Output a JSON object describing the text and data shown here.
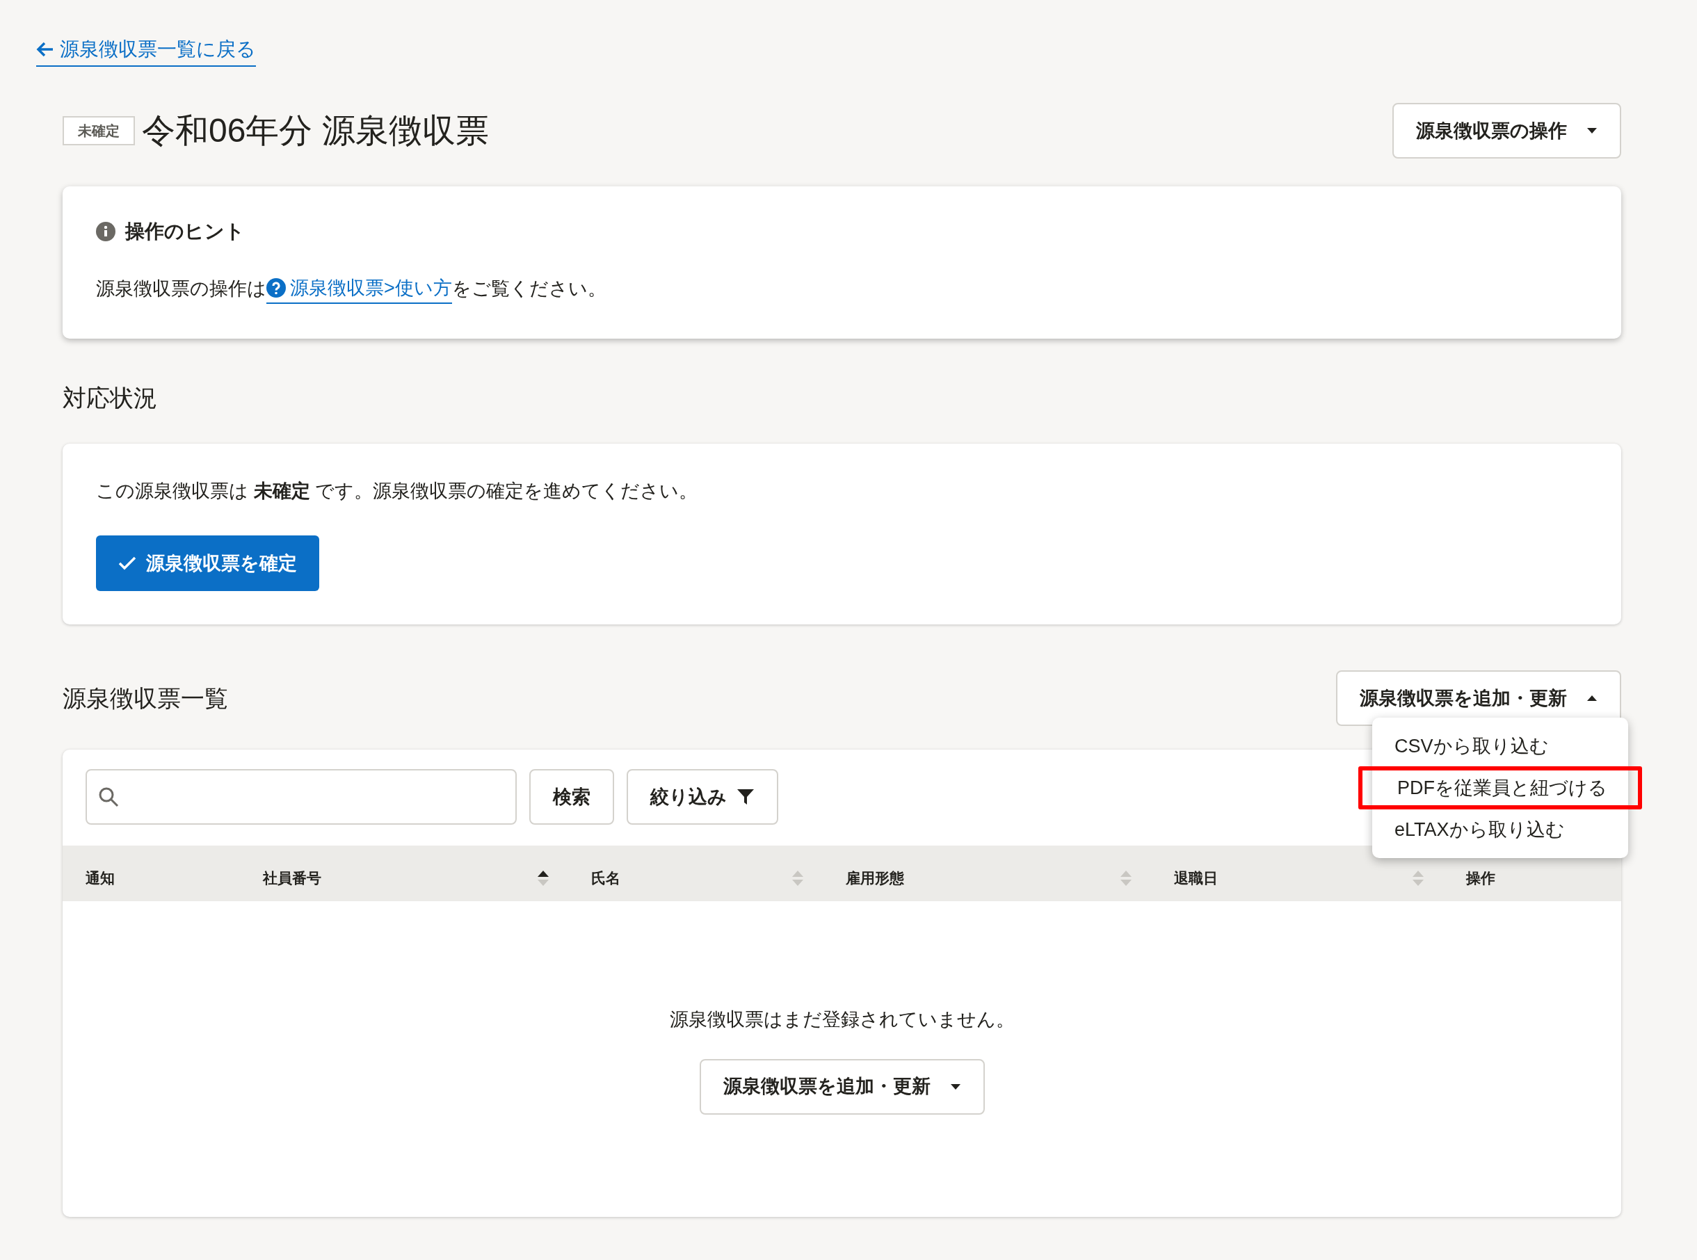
{
  "back_link": {
    "label": "源泉徴収票一覧に戻る"
  },
  "header": {
    "status_badge": "未確定",
    "title": "令和06年分 源泉徴収票",
    "actions_button": {
      "label": "源泉徴収票の操作",
      "expanded": false
    }
  },
  "hint": {
    "title": "操作のヒント",
    "text_before": "源泉徴収票の操作は",
    "link": "源泉徴収票>使い方",
    "text_after": "をご覧ください。"
  },
  "status_section": {
    "heading": "対応状況",
    "message": "この源泉徴収票は **未確定** です。源泉徴収票の確定を進めてください。",
    "confirm_button": "源泉徴収票を確定"
  },
  "list_section": {
    "heading": "源泉徴収票一覧",
    "add_button": {
      "label": "源泉徴収票を追加・更新",
      "expanded": true
    },
    "menu": [
      {
        "label": "CSVから取り込む",
        "highlighted": false
      },
      {
        "label": "PDFを従業員と紐づける",
        "highlighted": true
      },
      {
        "label": "eLTAXから取り込む",
        "highlighted": false
      }
    ],
    "search_button": "検索",
    "filter_button": "絞り込み",
    "columns": [
      {
        "label": "通知"
      },
      {
        "label": "社員番号",
        "sorted": true
      },
      {
        "label": "氏名",
        "sorted": false
      },
      {
        "label": "雇用形態",
        "sorted": false
      },
      {
        "label": "退職日",
        "sorted": false
      },
      {
        "label": "操作"
      }
    ],
    "empty_message": "源泉徴収票はまだ登録されていません。",
    "empty_add_button": {
      "label": "源泉徴収票を追加・更新",
      "expanded": false
    }
  }
}
